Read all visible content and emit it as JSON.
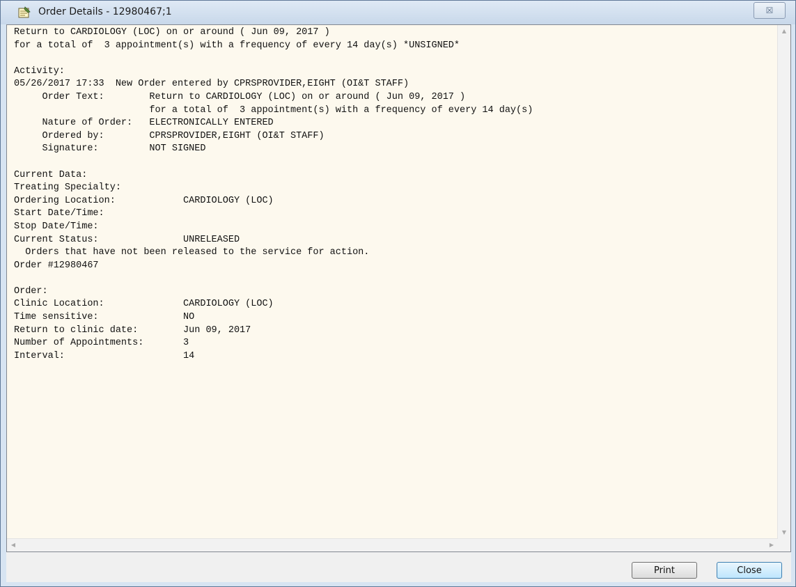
{
  "window": {
    "title": "Order Details - 12980467;1"
  },
  "icons": {
    "app": "notepad-icon",
    "close": "close-x-icon"
  },
  "title_controls": {
    "close_glyph": "☒"
  },
  "detail_text": [
    "Return to CARDIOLOGY (LOC) on or around ( Jun 09, 2017 )",
    "for a total of  3 appointment(s) with a frequency of every 14 day(s) *UNSIGNED*",
    "",
    "Activity:",
    "05/26/2017 17:33  New Order entered by CPRSPROVIDER,EIGHT (OI&T STAFF)",
    "     Order Text:        Return to CARDIOLOGY (LOC) on or around ( Jun 09, 2017 )",
    "                        for a total of  3 appointment(s) with a frequency of every 14 day(s)",
    "     Nature of Order:   ELECTRONICALLY ENTERED",
    "     Ordered by:        CPRSPROVIDER,EIGHT (OI&T STAFF)",
    "     Signature:         NOT SIGNED",
    "",
    "Current Data:",
    "Treating Specialty:",
    "Ordering Location:            CARDIOLOGY (LOC)",
    "Start Date/Time:",
    "Stop Date/Time:",
    "Current Status:               UNRELEASED",
    "  Orders that have not been released to the service for action.",
    "Order #12980467",
    "",
    "Order:",
    "Clinic Location:              CARDIOLOGY (LOC)",
    "Time sensitive:               NO",
    "Return to clinic date:        Jun 09, 2017",
    "Number of Appointments:       3",
    "Interval:                     14"
  ],
  "scroll": {
    "up": "▲",
    "down": "▼",
    "left": "◀",
    "right": "▶"
  },
  "buttons": {
    "print": "Print",
    "close": "Close"
  },
  "colors": {
    "memo_background": "#fdf9ee",
    "default_button": "#bee6fd"
  }
}
